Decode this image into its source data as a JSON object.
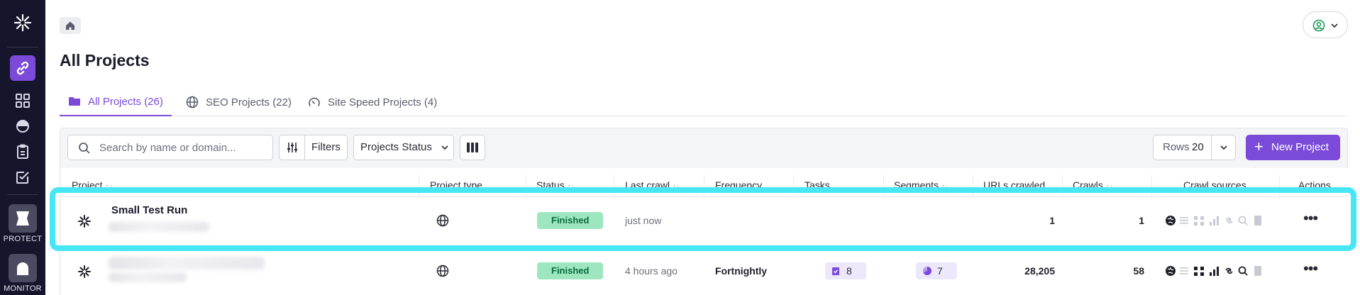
{
  "sidebar": {
    "items": [
      {
        "name": "logo",
        "icon": "asterisk-logo-icon"
      },
      {
        "name": "projects",
        "icon": "link-icon",
        "active": true
      },
      {
        "name": "dashboard",
        "icon": "grid-icon"
      },
      {
        "name": "reports",
        "icon": "gauge-icon"
      },
      {
        "name": "tasks",
        "icon": "clipboard-icon"
      },
      {
        "name": "checklist",
        "icon": "checkbox-icon"
      }
    ],
    "apps": [
      {
        "label": "PROTECT",
        "icon": "shield-app-icon"
      },
      {
        "label": "MONITOR",
        "icon": "monitor-app-icon"
      }
    ]
  },
  "header": {
    "title": "All Projects",
    "home_icon": "home-icon",
    "user_icon": "user-circle-icon"
  },
  "tabs": [
    {
      "label": "All Projects (26)",
      "icon": "folder-icon",
      "active": true
    },
    {
      "label": "SEO Projects (22)",
      "icon": "globe-icon",
      "active": false
    },
    {
      "label": "Site Speed Projects (4)",
      "icon": "speedometer-icon",
      "active": false
    }
  ],
  "toolbar": {
    "search_placeholder": "Search by name or domain...",
    "filters_label": "Filters",
    "status_label": "Projects Status",
    "rows_label": "Rows",
    "rows_value": "20",
    "new_project_label": "New Project"
  },
  "table": {
    "columns": [
      "Project",
      "Project type",
      "Status",
      "Last crawl",
      "Frequency",
      "Tasks",
      "Segments",
      "URLs crawled",
      "Crawls",
      "Crawl sources",
      "Actions"
    ],
    "rows": [
      {
        "name": "Small Test Run",
        "type_icon": "globe-icon",
        "status": "Finished",
        "last_crawl": "just now",
        "frequency": "",
        "tasks": "",
        "segments": "",
        "urls_crawled": "1",
        "crawls": "1",
        "highlighted": true
      },
      {
        "name": "",
        "type_icon": "globe-icon",
        "status": "Finished",
        "last_crawl": "4 hours ago",
        "frequency": "Fortnightly",
        "tasks": "8",
        "segments": "7",
        "urls_crawled": "28,205",
        "crawls": "58",
        "highlighted": false
      }
    ]
  },
  "colors": {
    "accent": "#7b4ad8",
    "sidebar_bg": "#15162b",
    "status_finished_bg": "#9ee6c0",
    "highlight": "#47e6f5"
  }
}
